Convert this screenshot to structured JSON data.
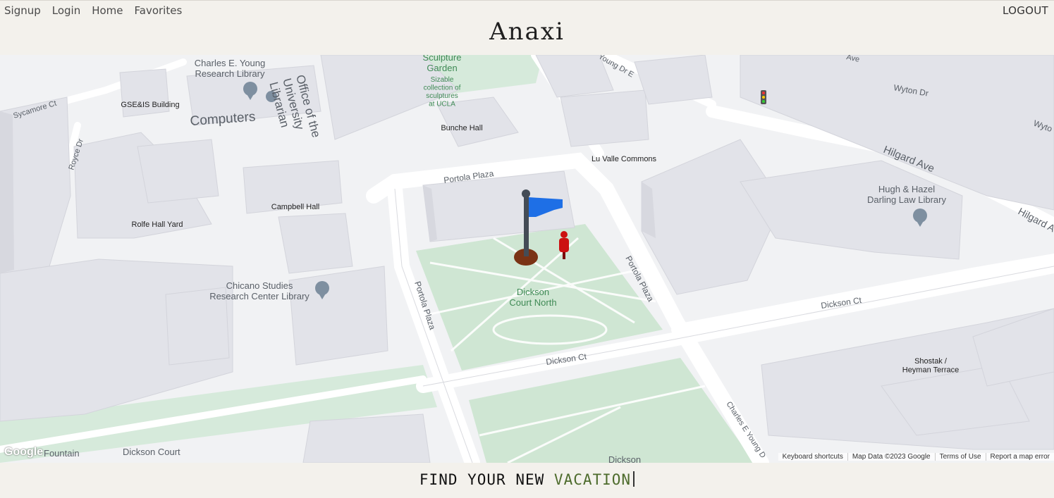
{
  "nav": {
    "items": [
      {
        "label": "Signup"
      },
      {
        "label": "Login"
      },
      {
        "label": "Home"
      },
      {
        "label": "Favorites"
      }
    ],
    "logout": "LOGOUT"
  },
  "brand": "Anaxi",
  "tagline": {
    "lead": "FIND YOUR NEW ",
    "accent": "VACATION"
  },
  "map": {
    "labels": {
      "young_library": "Charles E. Young Research Library",
      "gseis": "GSE&IS Building",
      "computers": "Computers",
      "university_librarian": "Office of the University Librarian",
      "sculpture_garden": "Sculpture Garden",
      "sculpture_desc": "Sizable collection of sculptures at UCLA",
      "bunche": "Bunche Hall",
      "young_dr_e": "Young Dr E",
      "wyton": "Wyton Dr",
      "wyton2": "Wyto",
      "hilgard": "Hilgard Ave",
      "hilgard2": "Hilgard A",
      "lu_valle": "Lu Valle Commons",
      "hugh_hazel": "Hugh & Hazel Darling Law Library",
      "sycamore": "Sycamore Ct",
      "royce_dr": "Royce Dr",
      "portola_top": "Portola Plaza",
      "portola_right": "Portola Plaza",
      "portola_left": "Portola Plaza",
      "campbell": "Campbell Hall",
      "rolfe": "Rolfe Hall Yard",
      "chicano": "Chicano Studies Research Center Library",
      "dickson_north": "Dickson Court North",
      "dickson_ct_mid": "Dickson Ct",
      "dickson_ct_right": "Dickson Ct",
      "charles_young_dr": "Charles E Young D",
      "shostak": "Shostak / Heyman Terrace",
      "dickson_court": "Dickson Court",
      "dickson_bottom": "Dickson",
      "fountain": "Fountain",
      "ave_top": "Ave"
    },
    "google": "Google",
    "attribution": {
      "shortcuts": "Keyboard shortcuts",
      "data": "Map Data ©2023 Google",
      "terms": "Terms of Use",
      "report": "Report a map error"
    },
    "colors": {
      "park": "#cfe6d3",
      "building": "#e2e3e9",
      "road": "#ffffff",
      "flag": "#1e6fe6",
      "pin": "#cc1111"
    }
  }
}
